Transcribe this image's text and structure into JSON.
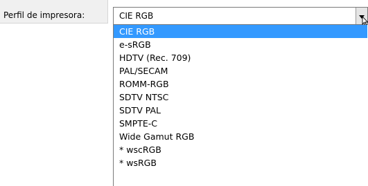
{
  "field": {
    "label": "Perfil de impresora:",
    "selected_value": "CIE RGB"
  },
  "icons": {
    "dropdown": "chevron-down-icon",
    "cursor": "mouse-pointer-icon"
  },
  "colors": {
    "selection": "#3399ff",
    "label_bg": "#f0f0f0"
  },
  "options": [
    {
      "label": "CIE RGB",
      "selected": true
    },
    {
      "label": "e-sRGB"
    },
    {
      "label": "HDTV (Rec. 709)"
    },
    {
      "label": "PAL/SECAM"
    },
    {
      "label": "ROMM-RGB"
    },
    {
      "label": "SDTV NTSC"
    },
    {
      "label": "SDTV PAL"
    },
    {
      "label": "SMPTE-C"
    },
    {
      "label": "Wide Gamut RGB"
    },
    {
      "label": "* wscRGB"
    },
    {
      "label": "* wsRGB"
    }
  ]
}
